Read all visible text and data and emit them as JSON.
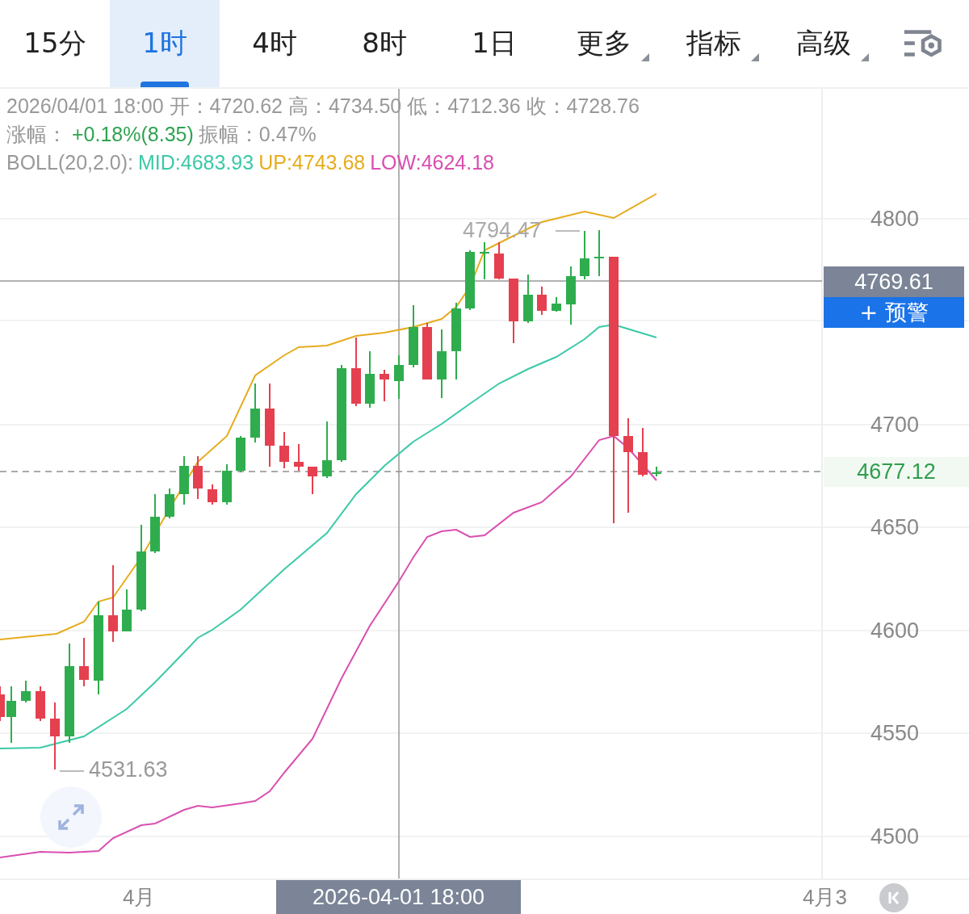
{
  "tabs": [
    {
      "label": "15分",
      "selected": false,
      "dropdown": false
    },
    {
      "label": "1时",
      "selected": true,
      "dropdown": false
    },
    {
      "label": "4时",
      "selected": false,
      "dropdown": false
    },
    {
      "label": "8时",
      "selected": false,
      "dropdown": false
    },
    {
      "label": "1日",
      "selected": false,
      "dropdown": false
    },
    {
      "label": "更多",
      "selected": false,
      "dropdown": true
    },
    {
      "label": "指标",
      "selected": false,
      "dropdown": true
    },
    {
      "label": "高级",
      "selected": false,
      "dropdown": true
    }
  ],
  "info": {
    "ohlc": "2026/04/01 18:00 开：4720.62 高：4734.50 低：4712.36 收：4728.76",
    "change_label": "涨幅：",
    "change": "+0.18%(8.35)",
    "amplitude": "振幅：0.47%",
    "boll_label": "BOLL(20,2.0):",
    "boll": [
      {
        "text": "MID:4683.93",
        "color": "#3cc9a8"
      },
      {
        "text": "UP:4743.68",
        "color": "#e6ac1e"
      },
      {
        "text": "LOW:4624.18",
        "color": "#d94fb0"
      }
    ]
  },
  "y_axis": [
    "4800",
    "4700",
    "4650",
    "4600",
    "4550",
    "4500"
  ],
  "crosshair_price": "4769.61",
  "alert_button": "+ 预警",
  "last_price": "4677.12",
  "high_marker": "4794.47",
  "low_marker": "4531.63",
  "x_axis": [
    "4月",
    "4月3"
  ],
  "crosshair_time": "2026-04-01 18:00"
}
